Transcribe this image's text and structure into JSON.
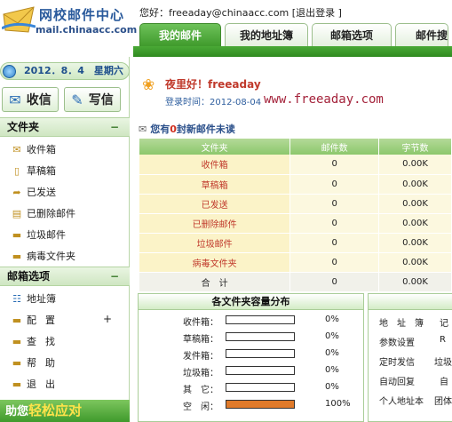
{
  "header": {
    "logo_title": "网校邮件中心",
    "logo_sub": "mail.chinaacc.com",
    "greeting_prefix": "您好：",
    "user_email": "freeaday@chinaacc.com",
    "logout_text": "[退出登录 ]",
    "tabs": [
      {
        "label": "我的邮件",
        "active": true
      },
      {
        "label": "我的地址簿",
        "active": false
      },
      {
        "label": "邮箱选项",
        "active": false
      },
      {
        "label": "邮件搜",
        "active": false
      }
    ]
  },
  "sidebar": {
    "date": "2012．8．4　星期六",
    "receive_label": "收信",
    "write_label": "写信",
    "folders_title": "文件夹",
    "folders": [
      {
        "label": "收件箱",
        "icon": "inbox-icon"
      },
      {
        "label": "草稿箱",
        "icon": "draft-icon"
      },
      {
        "label": "已发送",
        "icon": "sent-icon"
      },
      {
        "label": "已删除邮件",
        "icon": "trash-icon"
      },
      {
        "label": "垃圾邮件",
        "icon": "spam-folder-icon"
      },
      {
        "label": "病毒文件夹",
        "icon": "virus-folder-icon"
      }
    ],
    "options_title": "邮箱选项",
    "options": [
      {
        "label": "地址簿",
        "icon": "address-book-icon"
      },
      {
        "label": "配置",
        "icon": "folder-icon"
      },
      {
        "label": "查找",
        "icon": "folder-icon"
      },
      {
        "label": "帮助",
        "icon": "folder-icon"
      },
      {
        "label": "退出",
        "icon": "folder-icon"
      }
    ],
    "banner_prefix": "助您",
    "banner_suffix": "轻松应对"
  },
  "main": {
    "night_greeting": "夜里好！freeaday",
    "login_label": "登录时间：",
    "login_date": "2012-08-04",
    "site_url": "www.freeaday.com",
    "new_mail_prefix": "您有",
    "new_mail_count": "0",
    "new_mail_suffix": "封新邮件未读",
    "table": {
      "headers": [
        "文件夹",
        "邮件数",
        "字节数"
      ],
      "rows": [
        {
          "name": "收件箱",
          "count": "0",
          "bytes": "0.00K"
        },
        {
          "name": "草稿箱",
          "count": "0",
          "bytes": "0.00K"
        },
        {
          "name": "已发送",
          "count": "0",
          "bytes": "0.00K"
        },
        {
          "name": "已删除邮件",
          "count": "0",
          "bytes": "0.00K"
        },
        {
          "name": "垃圾邮件",
          "count": "0",
          "bytes": "0.00K"
        },
        {
          "name": "病毒文件夹",
          "count": "0",
          "bytes": "0.00K"
        }
      ],
      "total": {
        "name": "合　计",
        "count": "0",
        "bytes": "0.00K"
      }
    },
    "storage": {
      "title": "各文件夹容量分布",
      "rows": [
        {
          "label": "收件箱：",
          "pct": "0%",
          "fill": 0
        },
        {
          "label": "草稿箱：",
          "pct": "0%",
          "fill": 0
        },
        {
          "label": "发件箱：",
          "pct": "0%",
          "fill": 0
        },
        {
          "label": "垃圾箱：",
          "pct": "0%",
          "fill": 0
        },
        {
          "label": "其　它：",
          "pct": "0%",
          "fill": 0
        },
        {
          "label": "空　闲：",
          "pct": "100%",
          "fill": 1
        }
      ]
    },
    "tools": {
      "col1": [
        "地　址　簿",
        "参数设置",
        "定时发信",
        "自动回复",
        "个人地址本"
      ],
      "col2": [
        "记",
        "R",
        "垃圾",
        "自",
        "团体"
      ]
    }
  }
}
